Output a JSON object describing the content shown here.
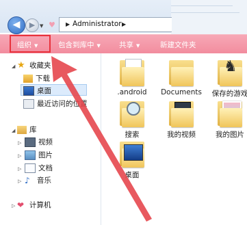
{
  "address": {
    "path_label": "Administrator"
  },
  "toolbar": {
    "organize": "组织",
    "include": "包含到库中",
    "share": "共享",
    "new_folder": "新建文件夹"
  },
  "nav": {
    "favorites": "收藏夹",
    "downloads": "下载",
    "desktop": "桌面",
    "recent": "最近访问的位置",
    "libraries": "库",
    "videos": "视频",
    "pictures": "图片",
    "documents": "文档",
    "music": "音乐",
    "computer": "计算机"
  },
  "files": [
    {
      "label": ".android"
    },
    {
      "label": "Documents"
    },
    {
      "label": "保存的游戏"
    },
    {
      "label": "搜索"
    },
    {
      "label": "我的视频"
    },
    {
      "label": "我的图片"
    },
    {
      "label": "桌面"
    }
  ],
  "colors": {
    "toolbar": "#f28c9e",
    "highlight_box": "#e8323c",
    "arrow": "#e5474e"
  }
}
